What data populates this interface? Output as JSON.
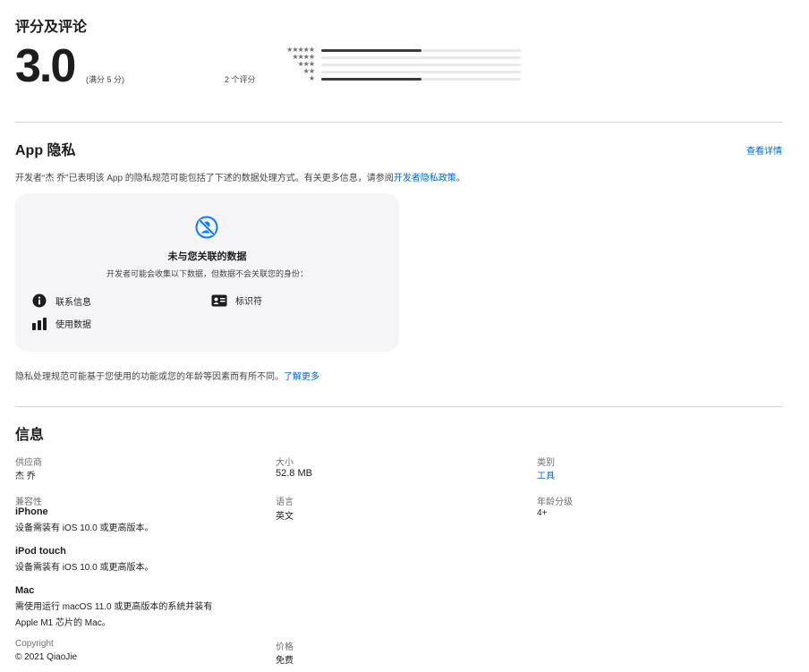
{
  "ratings": {
    "heading": "评分及评论",
    "score": "3.0",
    "out_of": "(满分 5 分)",
    "count": "2 个评分",
    "bars": [
      {
        "stars": "★★★★★",
        "fraction": 0.5
      },
      {
        "stars": "★★★★",
        "fraction": 0
      },
      {
        "stars": "★★★",
        "fraction": 0
      },
      {
        "stars": "★★",
        "fraction": 0
      },
      {
        "stars": "★",
        "fraction": 0.5
      }
    ]
  },
  "privacy": {
    "heading": "App 隐私",
    "details_link": "查看详情",
    "intro_text": "开发者“杰 乔”已表明该 App 的隐私规范可能包括了下述的数据处理方式。有关更多信息，请参阅",
    "intro_link": "开发者隐私政策",
    "intro_end": "。",
    "card": {
      "icon": "not-linked-icon",
      "title": "未与您关联的数据",
      "subtitle": "开发者可能会收集以下数据，但数据不会关联您的身份：",
      "items": [
        {
          "icon": "info-icon",
          "label": "联系信息"
        },
        {
          "icon": "id-card-icon",
          "label": "标识符"
        },
        {
          "icon": "bar-chart-icon",
          "label": "使用数据"
        }
      ]
    },
    "footnote": "隐私处理规范可能基于您使用的功能或您的年龄等因素而有所不同。",
    "footnote_link": "了解更多"
  },
  "info": {
    "heading": "信息",
    "provider_label": "供应商",
    "provider_value": "杰 乔",
    "size_label": "大小",
    "size_value": "52.8 MB",
    "category_label": "类别",
    "category_value": "工具",
    "compat_label": "兼容性",
    "compat": [
      {
        "device": "iPhone",
        "lines": [
          "设备需装有 iOS 10.0 或更高版本。"
        ]
      },
      {
        "device": "iPod touch",
        "lines": [
          "设备需装有 iOS 10.0 或更高版本。"
        ]
      },
      {
        "device": "Mac",
        "lines": [
          "需使用运行 macOS 11.0 或更高版本的系统并装有",
          "Apple M1 芯片的 Mac。"
        ]
      }
    ],
    "language_label": "语言",
    "language_value": "英文",
    "age_label": "年龄分级",
    "age_value": "4+",
    "copyright_label": "Copyright",
    "copyright_value": "© 2021 QiaoJie",
    "price_label": "价格",
    "price_value": "免费"
  },
  "colors": {
    "link": "#0066cc",
    "card_bg": "#f5f5f7",
    "privacy_icon": "#0a7aff"
  }
}
